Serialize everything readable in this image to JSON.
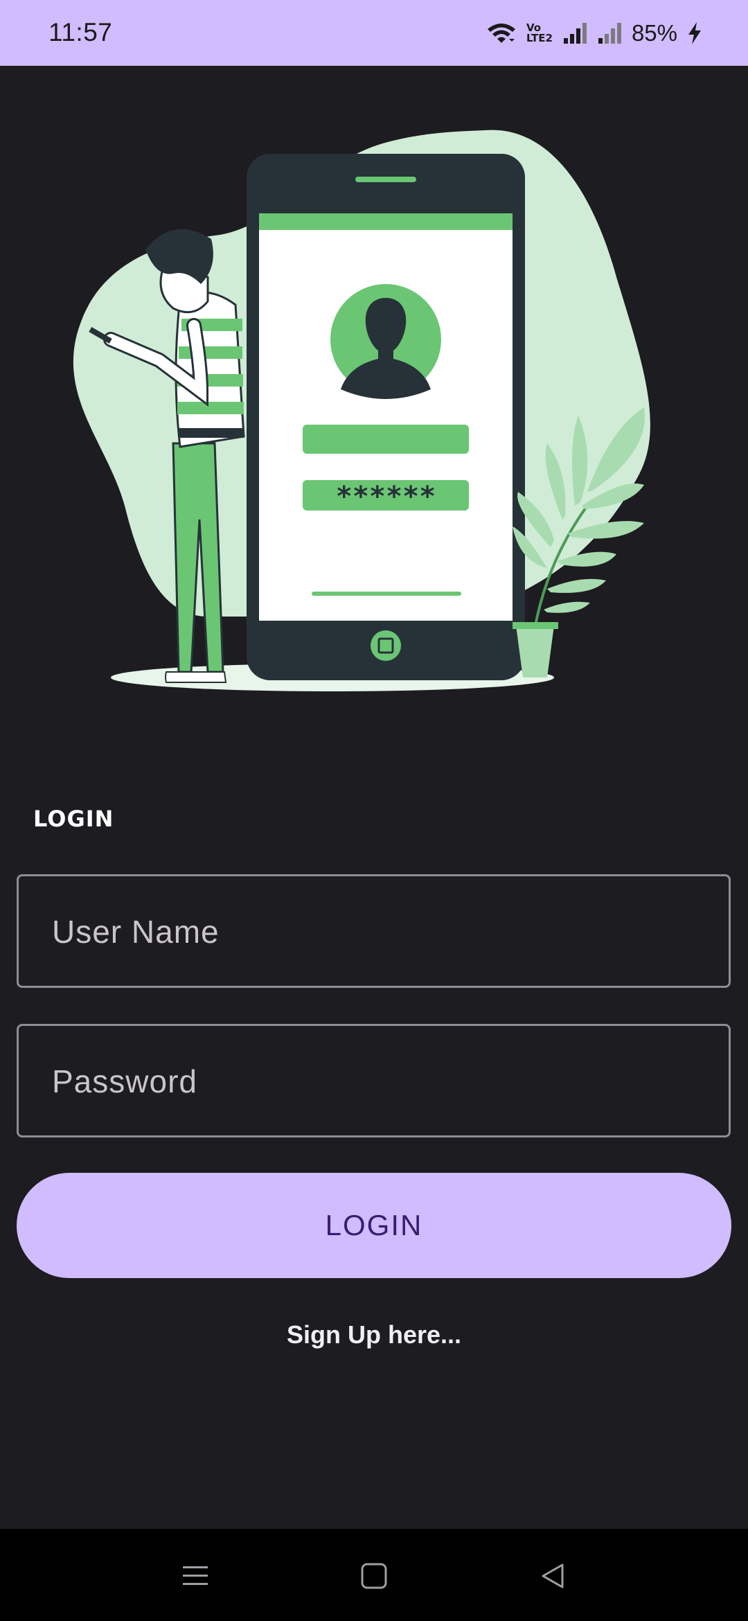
{
  "status_bar": {
    "time": "11:57",
    "network_label_top": "Vo",
    "network_label_bottom": "LTE2",
    "battery": "85%"
  },
  "icons": {
    "wifi": "wifi-icon",
    "signal_1": "cell-signal-icon",
    "signal_2": "cell-signal-weak-icon",
    "charging": "charging-bolt-icon",
    "menu": "menu-icon",
    "home": "home-square-icon",
    "back": "back-triangle-icon"
  },
  "illustration": {
    "password_mask": "******"
  },
  "login": {
    "section_title": "LOGIN",
    "username_placeholder": "User Name",
    "password_placeholder": "Password",
    "button_label": "LOGIN",
    "signup_link": "Sign Up here..."
  },
  "colors": {
    "background": "#1d1c21",
    "accent": "#d0bcfe",
    "accent_text": "#381e72",
    "illustration_green": "#6bc674",
    "illustration_dark": "#263238"
  }
}
